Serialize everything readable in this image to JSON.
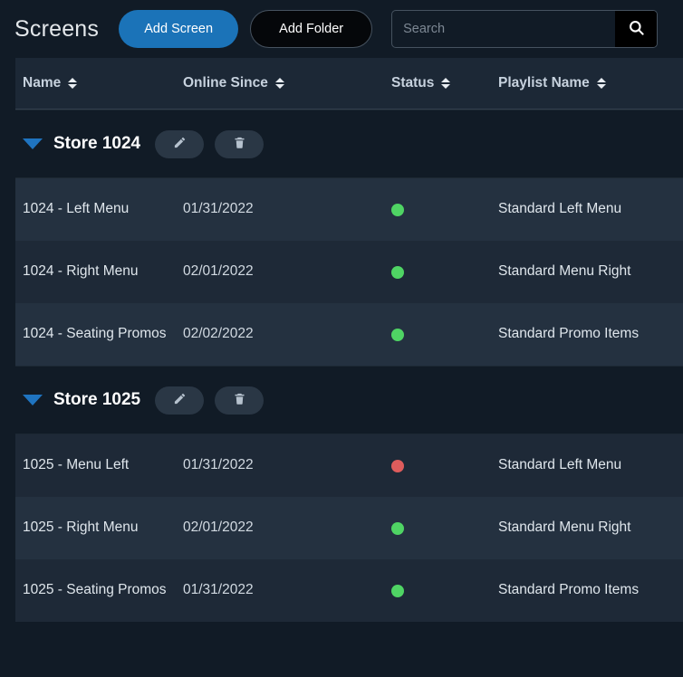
{
  "header": {
    "title": "Screens",
    "add_screen_label": "Add Screen",
    "add_folder_label": "Add Folder",
    "search_placeholder": "Search",
    "search_value": "",
    "search_icon": "search-icon"
  },
  "table": {
    "columns": [
      {
        "label": "Name",
        "sort_icon": "sort-icon"
      },
      {
        "label": "Online Since",
        "sort_icon": "sort-icon"
      },
      {
        "label": "Status",
        "sort_icon": "sort-icon"
      },
      {
        "label": "Playlist Name",
        "sort_icon": "sort-icon"
      }
    ]
  },
  "colors": {
    "page_bg": "#111b26",
    "row_bg": "#243140",
    "row_bg_alt": "#1e2937",
    "header_bg": "#1c2836",
    "accent_blue": "#1b73b8",
    "caret_blue": "#1f74c0",
    "status_online": "#4fd464",
    "status_offline": "#de5c5c",
    "pill_bg": "#2a3745"
  },
  "groups": [
    {
      "name": "Store 1024",
      "expanded": true,
      "edit_label": "edit-icon",
      "delete_label": "trash-icon",
      "rows": [
        {
          "name": "1024 - Left Menu",
          "online_since": "01/31/2022",
          "status": "online",
          "playlist": "Standard Left Menu"
        },
        {
          "name": "1024 - Right Menu",
          "online_since": "02/01/2022",
          "status": "online",
          "playlist": "Standard Menu Right"
        },
        {
          "name": "1024 - Seating Promos",
          "online_since": "02/02/2022",
          "status": "online",
          "playlist": "Standard Promo Items"
        }
      ]
    },
    {
      "name": "Store 1025",
      "expanded": true,
      "edit_label": "edit-icon",
      "delete_label": "trash-icon",
      "rows": [
        {
          "name": "1025 - Menu Left",
          "online_since": "01/31/2022",
          "status": "offline",
          "playlist": "Standard Left Menu"
        },
        {
          "name": "1025 - Right Menu",
          "online_since": "02/01/2022",
          "status": "online",
          "playlist": "Standard Menu Right"
        },
        {
          "name": "1025 - Seating Promos",
          "online_since": "01/31/2022",
          "status": "online",
          "playlist": "Standard Promo Items"
        }
      ]
    }
  ]
}
